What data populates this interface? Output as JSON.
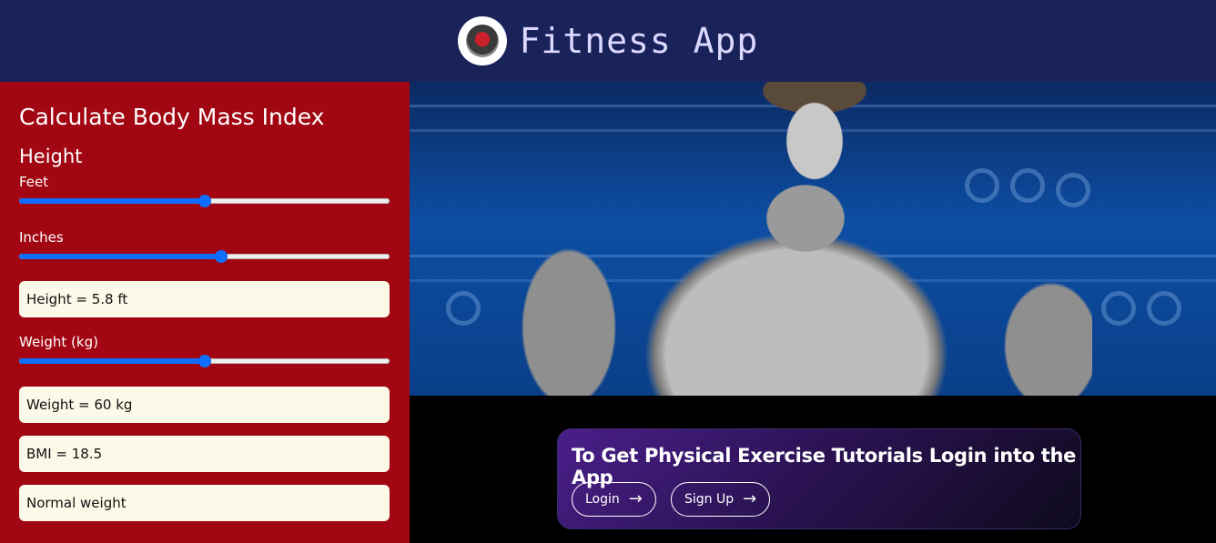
{
  "header": {
    "title": "Fitness App",
    "logo_icon": "gym-logo-icon"
  },
  "bmi": {
    "title": "Calculate Body Mass Index",
    "height_section": "Height",
    "feet_label": "Feet",
    "feet_level": 0.5,
    "inches_label": "Inches",
    "inches_level": 0.545,
    "height_result": "Height = 5.8 ft",
    "weight_label": "Weight (kg)",
    "weight_level": 0.5,
    "weight_result": "Weight = 60 kg",
    "bmi_result": "BMI = 18.5",
    "category_result": "Normal weight"
  },
  "cta": {
    "text": "To Get Physical Exercise Tutorials Login into the App",
    "login_label": "Login",
    "signup_label": "Sign Up"
  },
  "colors": {
    "header_bg": "#19235a",
    "panel_bg": "#a10612",
    "slider_accent": "#0e6efd",
    "result_bg": "#fdf9e8"
  }
}
